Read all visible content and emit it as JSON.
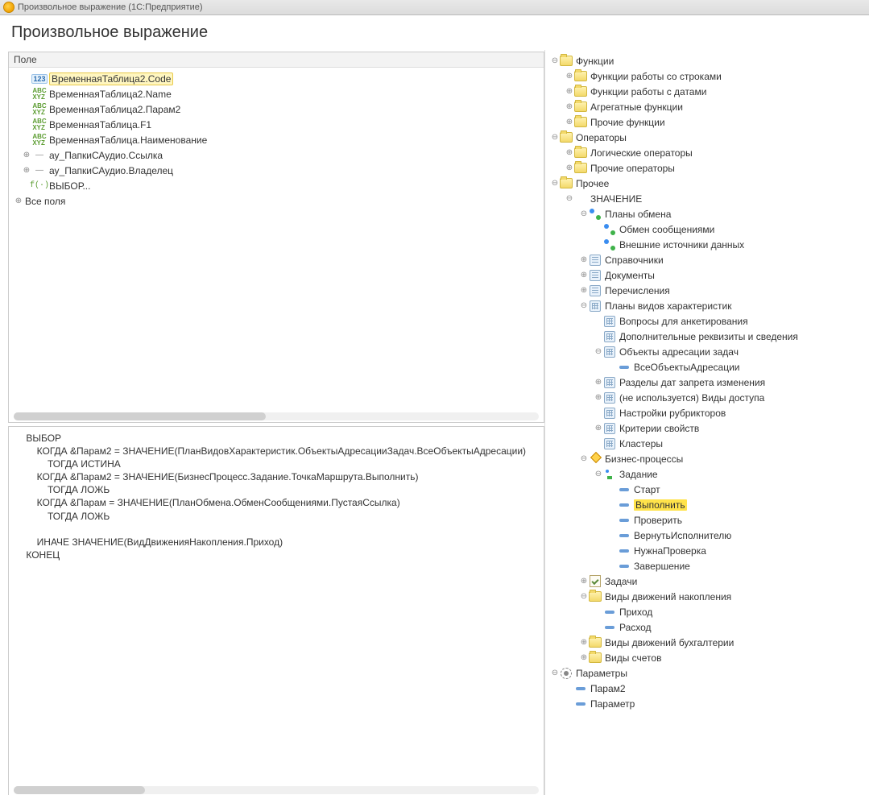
{
  "window_title": "Произвольное выражение  (1С:Предприятие)",
  "heading": "Произвольное выражение",
  "fields": {
    "header": "Поле",
    "items": [
      {
        "icon": "num",
        "label": "ВременнаяТаблица2.Code",
        "selected": true
      },
      {
        "icon": "abc",
        "label": "ВременнаяТаблица2.Name"
      },
      {
        "icon": "abc",
        "label": "ВременнаяТаблица2.Парам2"
      },
      {
        "icon": "abc",
        "label": "ВременнаяТаблица.F1"
      },
      {
        "icon": "abc",
        "label": "ВременнаяТаблица.Наименование"
      },
      {
        "icon": "ref",
        "label": "ау_ПапкиСАудио.Ссылка",
        "expand": true
      },
      {
        "icon": "ref",
        "label": "ау_ПапкиСАудио.Владелец",
        "expand": true
      },
      {
        "icon": "fx",
        "label": "ВЫБОР..."
      }
    ],
    "all_fields_label": "Все поля"
  },
  "editor_text": "    ВЫБОР\n        КОГДА &Парам2 = ЗНАЧЕНИЕ(ПланВидовХарактеристик.ОбъектыАдресацииЗадач.ВсеОбъектыАдресации)\n            ТОГДА ИСТИНА\n        КОГДА &Парам2 = ЗНАЧЕНИЕ(БизнесПроцесс.Задание.ТочкаМаршрута.Выполнить)\n            ТОГДА ЛОЖЬ\n        КОГДА &Парам = ЗНАЧЕНИЕ(ПланОбмена.ОбменСообщениями.ПустаяСсылка)\n            ТОГДА ЛОЖЬ\n\n        ИНАЧЕ ЗНАЧЕНИЕ(ВидДвиженияНакопления.Приход)\n    КОНЕЦ",
  "tree": {
    "functions": "Функции",
    "fn_strings": "Функции работы со строками",
    "fn_dates": "Функции работы с датами",
    "fn_aggregate": "Агрегатные функции",
    "fn_other": "Прочие функции",
    "operators": "Операторы",
    "op_logical": "Логические операторы",
    "op_other": "Прочие операторы",
    "misc": "Прочее",
    "value": "ЗНАЧЕНИЕ",
    "exch_plans": "Планы обмена",
    "exch_msg": "Обмен сообщениями",
    "ext_sources": "Внешние источники данных",
    "catalogs": "Справочники",
    "documents": "Документы",
    "enums": "Перечисления",
    "char_plans": "Планы видов характеристик",
    "questions": "Вопросы для анкетирования",
    "extra_props": "Дополнительные реквизиты и сведения",
    "addr_objects": "Объекты адресации задач",
    "all_addr": "ВсеОбъектыАдресации",
    "lock_sections": "Разделы дат запрета изменения",
    "unused_access": "(не используется) Виды доступа",
    "rubricators": "Настройки рубрикторов",
    "prop_criteria": "Критерии свойств",
    "clusters": "Кластеры",
    "bp": "Бизнес-процессы",
    "task": "Задание",
    "start": "Старт",
    "execute": "Выполнить",
    "check": "Проверить",
    "return": "ВернутьИсполнителю",
    "need_check": "НужнаПроверка",
    "finish": "Завершение",
    "tasks": "Задачи",
    "acc_moves": "Виды движений накопления",
    "income": "Приход",
    "expense": "Расход",
    "bookkeep_moves": "Виды движений бухгалтерии",
    "account_types": "Виды счетов",
    "parameters": "Параметры",
    "param2": "Парам2",
    "param": "Параметр"
  }
}
